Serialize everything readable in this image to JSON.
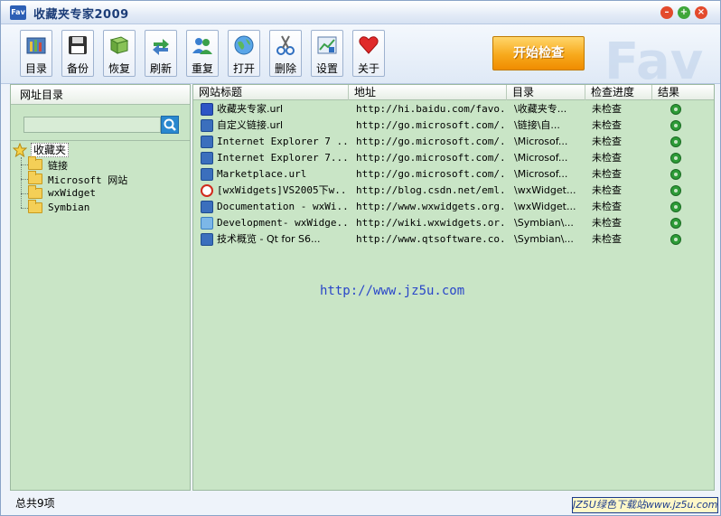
{
  "window": {
    "title": "收藏夹专家2009",
    "logo_text": "Fav"
  },
  "toolbar": {
    "buttons": [
      {
        "label": "目录",
        "icon": "catalog-icon"
      },
      {
        "label": "备份",
        "icon": "floppy-disk-icon"
      },
      {
        "label": "恢复",
        "icon": "restore-book-icon"
      },
      {
        "label": "刷新",
        "icon": "refresh-arrows-icon"
      },
      {
        "label": "重复",
        "icon": "duplicate-users-icon"
      },
      {
        "label": "打开",
        "icon": "globe-icon"
      },
      {
        "label": "删除",
        "icon": "scissors-icon"
      },
      {
        "label": "设置",
        "icon": "settings-chart-icon"
      },
      {
        "label": "关于",
        "icon": "heart-icon"
      }
    ],
    "start_check": "开始检查"
  },
  "left_panel": {
    "header": "网址目录",
    "search": {
      "value": "",
      "placeholder": ""
    },
    "tree": {
      "root": "收藏夹",
      "children": [
        "链接",
        "Microsoft 网站",
        "wxWidget",
        "Symbian"
      ]
    }
  },
  "table": {
    "columns": [
      "网站标题",
      "地址",
      "目录",
      "检查进度",
      "结果"
    ],
    "rows": [
      {
        "title": "收藏夹专家.url",
        "url": "http://hi.baidu.com/favo...",
        "dir": "\\收藏夹专...",
        "progress": "未检查",
        "icon": "baidu-icon"
      },
      {
        "title": "自定义链接.url",
        "url": "http://go.microsoft.com/...",
        "dir": "\\链接\\自...",
        "progress": "未检查",
        "icon": "ie-icon"
      },
      {
        "title": "Internet Explorer 7 ...",
        "url": "http://go.microsoft.com/...",
        "dir": "\\Microsof...",
        "progress": "未检查",
        "icon": "ie-icon"
      },
      {
        "title": "Internet Explorer 7...",
        "url": "http://go.microsoft.com/...",
        "dir": "\\Microsof...",
        "progress": "未检查",
        "icon": "ie-icon"
      },
      {
        "title": "Marketplace.url",
        "url": "http://go.microsoft.com/...",
        "dir": "\\Microsof...",
        "progress": "未检查",
        "icon": "ie-icon"
      },
      {
        "title": "[wxWidgets]VS2005下w...",
        "url": "http://blog.csdn.net/eml...",
        "dir": "\\wxWidget...",
        "progress": "未检查",
        "icon": "csdn-icon"
      },
      {
        "title": "Documentation - wxWi...",
        "url": "http://www.wxwidgets.org...",
        "dir": "\\wxWidget...",
        "progress": "未检查",
        "icon": "ie-icon"
      },
      {
        "title": "Development- wxWidge...",
        "url": "http://wiki.wxwidgets.or...",
        "dir": "\\Symbian\\...",
        "progress": "未检查",
        "icon": "wiki-icon"
      },
      {
        "title": "技术概览 - Qt for S6...",
        "url": "http://www.qtsoftware.co...",
        "dir": "\\Symbian\\...",
        "progress": "未检查",
        "icon": "ie-icon"
      }
    ],
    "watermark": "http://www.jz5u.com"
  },
  "status": {
    "text": "总共9项",
    "banner": "JZ5U绿色下载站www.jz5u.com"
  }
}
